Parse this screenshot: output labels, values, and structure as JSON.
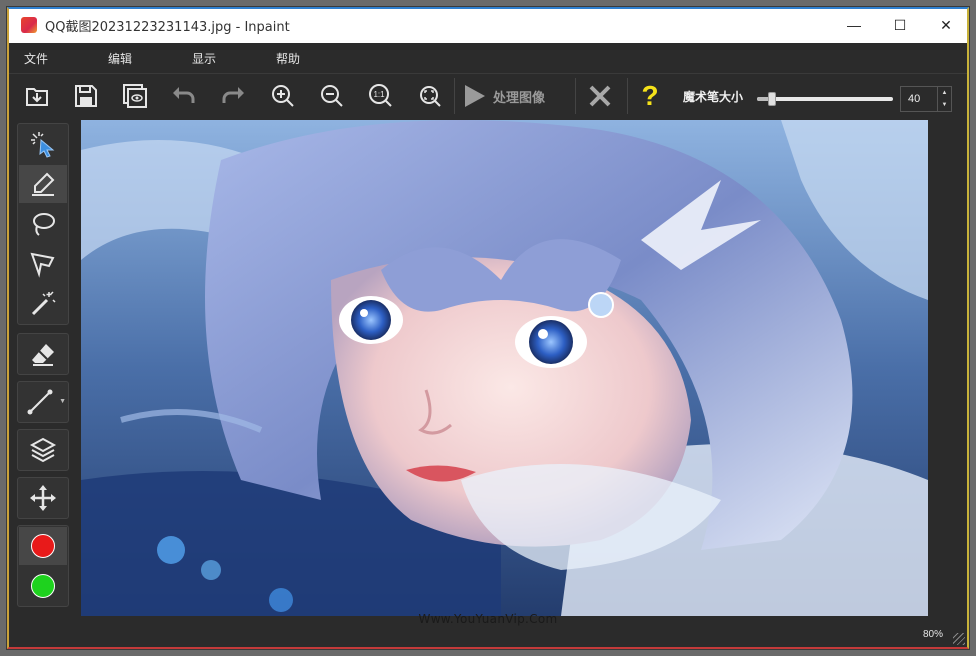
{
  "window": {
    "title": "QQ截图20231223231143.jpg - Inpaint",
    "controls": {
      "minimize": "—",
      "maximize": "☐",
      "close": "✕"
    }
  },
  "menu": [
    {
      "label": "文件"
    },
    {
      "label": "编辑"
    },
    {
      "label": "显示"
    },
    {
      "label": "帮助"
    }
  ],
  "toolbar": {
    "buttons": [
      "open-icon",
      "save-icon",
      "save-copy-icon",
      "undo-icon",
      "redo-icon",
      "zoom-in-icon",
      "zoom-out-icon",
      "zoom-actual-icon",
      "zoom-fit-icon"
    ],
    "zoom_actual_text": "1:1",
    "process_label": "处理图像",
    "cancel_icon": "close-x-icon",
    "help_text": "?",
    "brush_size_label": "魔术笔大小",
    "brush_size_value": "40",
    "brush_size_fraction": 0.05
  },
  "tools": [
    {
      "name": "magic-wand-select-icon",
      "active": false
    },
    {
      "name": "marker-icon",
      "active": true
    },
    {
      "name": "lasso-icon",
      "active": false
    },
    {
      "name": "polygon-lasso-icon",
      "active": false
    },
    {
      "name": "magic-wand-icon",
      "active": false
    },
    {
      "name": "eraser-icon",
      "active": false
    },
    {
      "name": "guide-line-icon",
      "active": false
    },
    {
      "name": "layers-icon",
      "active": false
    },
    {
      "name": "move-icon",
      "active": false
    }
  ],
  "colors": {
    "red_swatch": "#e81a1a",
    "green_swatch": "#1ed21e",
    "accent_yellow": "#f5e21a"
  },
  "canvas": {
    "watermark": "Www.YouYuanVip.Com"
  },
  "status": {
    "zoom": "80%"
  }
}
